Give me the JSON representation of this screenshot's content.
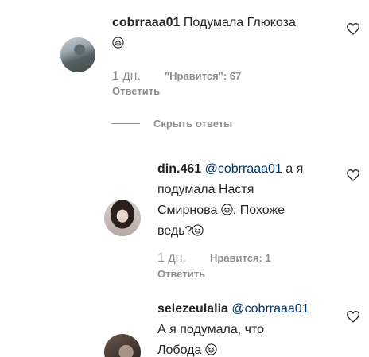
{
  "comments": [
    {
      "username": "cobrraaa01",
      "text": "Подумала Глюкоза",
      "date": "1 дн.",
      "likes": "\"Нравится\": 67",
      "reply": "Ответить"
    }
  ],
  "hide_replies": "Скрыть ответы",
  "replies": [
    {
      "username": "din.461",
      "mention": "@cobrraaa01",
      "text_line1": "а я",
      "text_line2": "подумала Настя",
      "text_line3": "Смирнова",
      "text_line3b": ". Похоже",
      "text_line4": "ведь?",
      "date": "1 дн.",
      "likes": "Нравится: 1",
      "reply": "Ответить"
    },
    {
      "username": "selezeulalia",
      "mention": "@cobrraaa01",
      "text_line1": "А я подумала, что",
      "text_line2": "Лобода"
    }
  ],
  "icons": {
    "like": "heart-icon",
    "emoji": "grinning-squinting-face-icon"
  },
  "colors": {
    "text": "#262626",
    "secondary": "#8e8e8e",
    "mention": "#003569"
  }
}
